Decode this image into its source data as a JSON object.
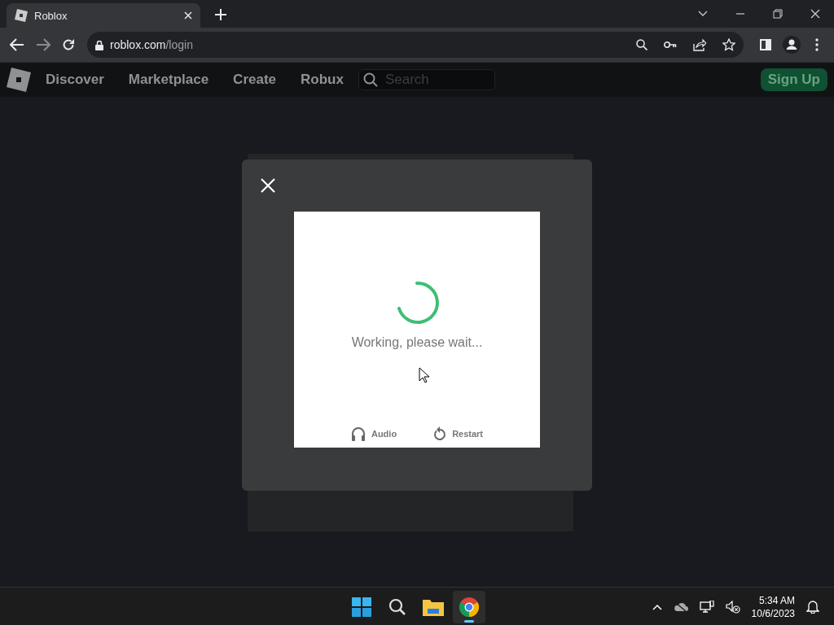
{
  "browser": {
    "tab": {
      "title": "Roblox",
      "selected": true
    },
    "url_host": "roblox.com",
    "url_path": "/login"
  },
  "nav": {
    "links": [
      "Discover",
      "Marketplace",
      "Create",
      "Robux"
    ],
    "search": {
      "placeholder": "Search"
    },
    "signup": "Sign Up"
  },
  "modal": {
    "status": "Working, please wait...",
    "actions": [
      {
        "kind": "audio",
        "label": "Audio"
      },
      {
        "kind": "restart",
        "label": "Restart"
      }
    ]
  },
  "taskbar": {
    "apps": [
      {
        "kind": "start",
        "selected": false
      },
      {
        "kind": "search",
        "selected": false
      },
      {
        "kind": "files",
        "selected": false
      },
      {
        "kind": "chrome",
        "selected": true
      }
    ],
    "time": "5:34 AM",
    "date": "10/6/2023"
  }
}
